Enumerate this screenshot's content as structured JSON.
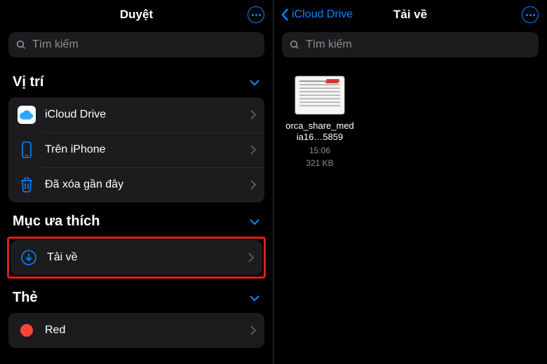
{
  "left": {
    "title": "Duyệt",
    "search_placeholder": "Tìm kiếm",
    "sections": {
      "locations": {
        "title": "Vị trí",
        "items": [
          {
            "label": "iCloud Drive"
          },
          {
            "label": "Trên iPhone"
          },
          {
            "label": "Đã xóa gần đây"
          }
        ]
      },
      "favorites": {
        "title": "Mục ưa thích",
        "items": [
          {
            "label": "Tải về"
          }
        ]
      },
      "tags": {
        "title": "Thẻ",
        "items": [
          {
            "label": "Red",
            "color": "#ff453a"
          }
        ]
      }
    }
  },
  "right": {
    "back_label": "iCloud Drive",
    "title": "Tải về",
    "search_placeholder": "Tìm kiếm",
    "files": [
      {
        "name": "orca_share_media16…5859",
        "time": "15:06",
        "size": "321 KB"
      }
    ]
  }
}
